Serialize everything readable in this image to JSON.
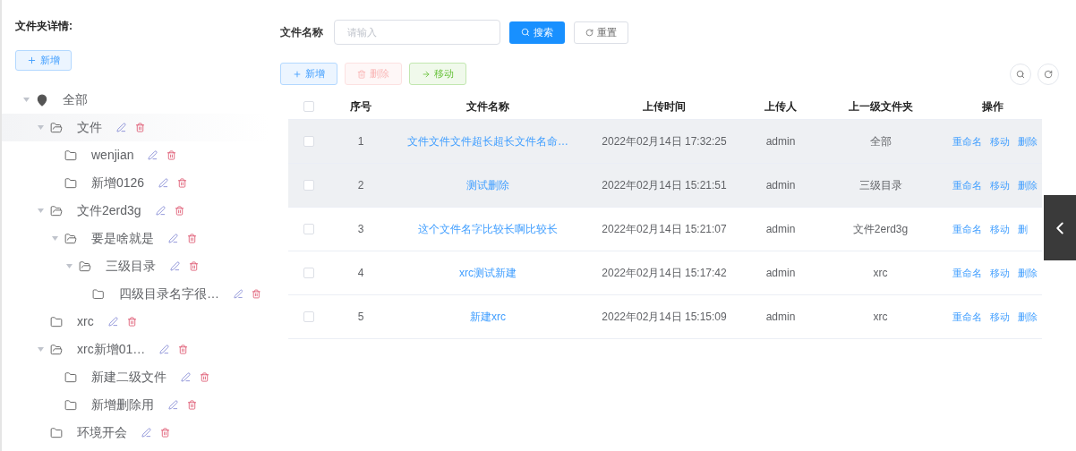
{
  "sidebar": {
    "title": "文件夹详情:",
    "add_button": "新增",
    "tree": [
      {
        "label": "全部",
        "kind": "root",
        "expanded": true,
        "highlighted": false,
        "children": [
          {
            "label": "文件",
            "kind": "folder",
            "expanded": true,
            "highlighted": true,
            "children": [
              {
                "label": "wenjian",
                "kind": "folder",
                "highlighted": false
              },
              {
                "label": "新增0126",
                "kind": "folder",
                "highlighted": false
              }
            ]
          },
          {
            "label": "文件2erd3g",
            "kind": "folder",
            "expanded": true,
            "highlighted": false,
            "children": [
              {
                "label": "要是啥就是",
                "kind": "folder",
                "expanded": true,
                "highlighted": false,
                "children": [
                  {
                    "label": "三级目录",
                    "kind": "folder",
                    "expanded": true,
                    "highlighted": false,
                    "children": [
                      {
                        "label": "四级目录名字很…",
                        "kind": "folder",
                        "highlighted": false
                      }
                    ]
                  }
                ]
              }
            ]
          },
          {
            "label": "xrc",
            "kind": "folder",
            "highlighted": false
          },
          {
            "label": "xrc新增01…",
            "kind": "folder",
            "expanded": true,
            "highlighted": false,
            "children": [
              {
                "label": "新建二级文件",
                "kind": "folder",
                "highlighted": false
              },
              {
                "label": "新增删除用",
                "kind": "folder",
                "highlighted": false
              }
            ]
          },
          {
            "label": "环境开会",
            "kind": "folder",
            "highlighted": false
          }
        ]
      }
    ]
  },
  "search": {
    "label": "文件名称",
    "placeholder": "请输入",
    "search_button": "搜索",
    "reset_button": "重置"
  },
  "toolbar": [
    {
      "label": "新增",
      "kind": "add",
      "disabled": false
    },
    {
      "label": "删除",
      "kind": "delete",
      "disabled": true
    },
    {
      "label": "移动",
      "kind": "move",
      "disabled": false
    }
  ],
  "table": {
    "select_all": {
      "checked": false
    },
    "columns": [
      "序号",
      "文件名称",
      "上传时间",
      "上传人",
      "上一级文件夹",
      "操作"
    ],
    "rows": [
      {
        "checked": false,
        "highlighted": true,
        "cells": [
          "1",
          "文件文件文件超长超长文件名命…",
          "2022年02月14日 17:32:25",
          "admin",
          "全部"
        ],
        "actions": [
          "重命名",
          "移动",
          "删除"
        ]
      },
      {
        "checked": false,
        "highlighted": true,
        "cells": [
          "2",
          "测试删除",
          "2022年02月14日 15:21:51",
          "admin",
          "三级目录"
        ],
        "actions": [
          "重命名",
          "移动",
          "删除"
        ]
      },
      {
        "checked": false,
        "highlighted": false,
        "cells": [
          "3",
          "这个文件名字比较长啊比较长",
          "2022年02月14日 15:21:07",
          "admin",
          "文件2erd3g"
        ],
        "actions": [
          "重命名",
          "移动",
          "删"
        ]
      },
      {
        "checked": false,
        "highlighted": false,
        "cells": [
          "4",
          "xrc测试新建",
          "2022年02月14日 15:17:42",
          "admin",
          "xrc"
        ],
        "actions": [
          "重命名",
          "移动",
          "删除"
        ]
      },
      {
        "checked": false,
        "highlighted": false,
        "cells": [
          "5",
          "新建xrc",
          "2022年02月14日 15:15:09",
          "admin",
          "xrc"
        ],
        "actions": [
          "重命名",
          "移动",
          "删除"
        ]
      }
    ]
  }
}
